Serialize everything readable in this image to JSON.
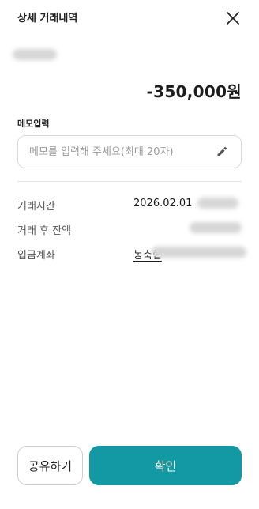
{
  "header": {
    "title": "상세 거래내역",
    "close_icon": "close-icon"
  },
  "transaction": {
    "amount": "-350,000원"
  },
  "memo": {
    "label": "메모입력",
    "placeholder": "메모를 입력해 주세요(최대 20자)",
    "value": "",
    "edit_icon": "pencil-icon"
  },
  "details": {
    "time_label": "거래시간",
    "time_value": "2026.02.01",
    "balance_label": "거래 후 잔액",
    "account_label": "입금계좌",
    "account_bank": "농축협"
  },
  "actions": {
    "share_label": "공유하기",
    "confirm_label": "확인"
  },
  "colors": {
    "accent": "#1399a3",
    "text": "#1c1c1c",
    "border": "#d9d9d9"
  }
}
